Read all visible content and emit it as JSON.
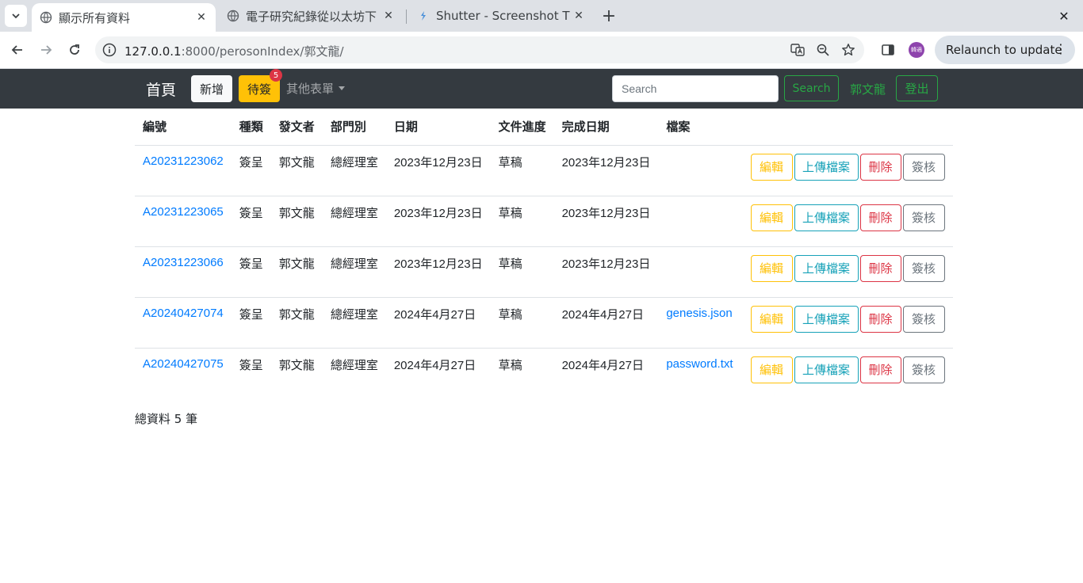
{
  "browser": {
    "tabs": [
      {
        "title": "顯示所有資料",
        "active": true
      },
      {
        "title": "電子研究紀錄從以太坊下",
        "active": false
      },
      {
        "title": "Shutter - Screenshot T",
        "active": false
      }
    ],
    "url_host": "127.0.0.1",
    "url_path": ":8000/perosonIndex/郭文龍/",
    "profile_text": "韓適",
    "relaunch_label": "Relaunch to update"
  },
  "navbar": {
    "brand": "首頁",
    "new_label": "新增",
    "pending_label": "待簽",
    "pending_count": "5",
    "other_forms_label": "其他表單",
    "search_placeholder": "Search",
    "search_button": "Search",
    "user_name": "郭文龍",
    "logout_label": "登出"
  },
  "table": {
    "headers": [
      "編號",
      "種類",
      "發文者",
      "部門別",
      "日期",
      "文件進度",
      "完成日期",
      "檔案",
      ""
    ],
    "action_labels": {
      "edit": "編輯",
      "upload": "上傳檔案",
      "delete": "刪除",
      "sign": "簽核"
    },
    "rows": [
      {
        "id": "A20231223062",
        "type": "簽呈",
        "author": "郭文龍",
        "dept": "總經理室",
        "date": "2023年12月23日",
        "status": "草稿",
        "done_date": "2023年12月23日",
        "file": ""
      },
      {
        "id": "A20231223065",
        "type": "簽呈",
        "author": "郭文龍",
        "dept": "總經理室",
        "date": "2023年12月23日",
        "status": "草稿",
        "done_date": "2023年12月23日",
        "file": ""
      },
      {
        "id": "A20231223066",
        "type": "簽呈",
        "author": "郭文龍",
        "dept": "總經理室",
        "date": "2023年12月23日",
        "status": "草稿",
        "done_date": "2023年12月23日",
        "file": ""
      },
      {
        "id": "A20240427074",
        "type": "簽呈",
        "author": "郭文龍",
        "dept": "總經理室",
        "date": "2024年4月27日",
        "status": "草稿",
        "done_date": "2024年4月27日",
        "file": "genesis.json"
      },
      {
        "id": "A20240427075",
        "type": "簽呈",
        "author": "郭文龍",
        "dept": "總經理室",
        "date": "2024年4月27日",
        "status": "草稿",
        "done_date": "2024年4月27日",
        "file": "password.txt"
      }
    ]
  },
  "footer": {
    "total_text": "總資料 5 筆"
  }
}
